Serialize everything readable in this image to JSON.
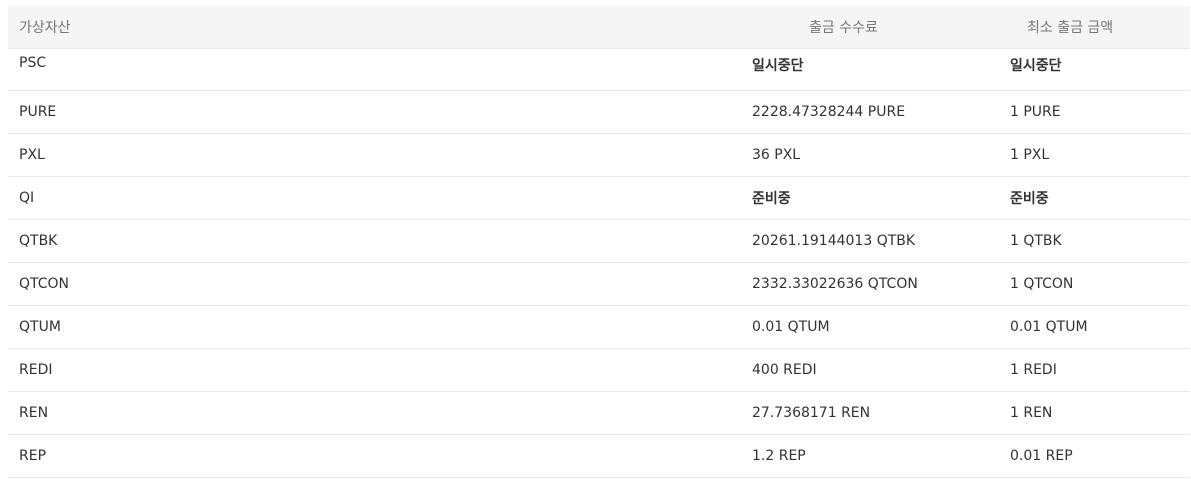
{
  "table": {
    "headers": {
      "asset": "가상자산",
      "fee": "출금 수수료",
      "min": "최소 출금 금액"
    },
    "rows": [
      {
        "asset": "PSC",
        "fee": "일시중단",
        "min": "일시중단",
        "status": true
      },
      {
        "asset": "PURE",
        "fee": "2228.47328244 PURE",
        "min": "1 PURE",
        "status": false
      },
      {
        "asset": "PXL",
        "fee": "36 PXL",
        "min": "1 PXL",
        "status": false
      },
      {
        "asset": "QI",
        "fee": "준비중",
        "min": "준비중",
        "status": true
      },
      {
        "asset": "QTBK",
        "fee": "20261.19144013 QTBK",
        "min": "1 QTBK",
        "status": false
      },
      {
        "asset": "QTCON",
        "fee": "2332.33022636 QTCON",
        "min": "1 QTCON",
        "status": false
      },
      {
        "asset": "QTUM",
        "fee": "0.01 QTUM",
        "min": "0.01 QTUM",
        "status": false
      },
      {
        "asset": "REDI",
        "fee": "400 REDI",
        "min": "1 REDI",
        "status": false
      },
      {
        "asset": "REN",
        "fee": "27.7368171 REN",
        "min": "1 REN",
        "status": false
      },
      {
        "asset": "REP",
        "fee": "1.2 REP",
        "min": "0.01 REP",
        "status": false
      }
    ]
  }
}
